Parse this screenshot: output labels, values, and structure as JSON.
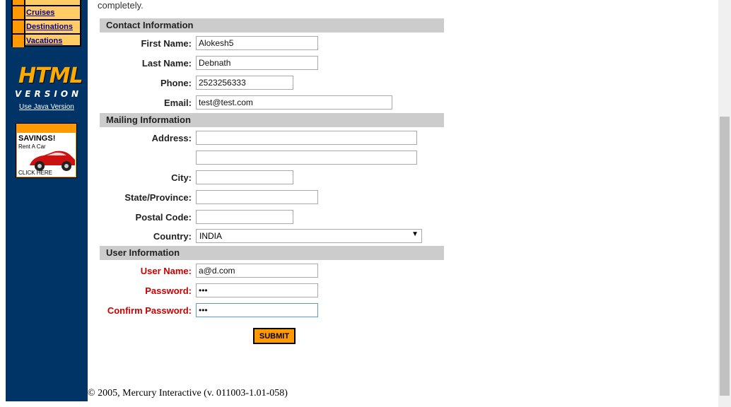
{
  "nav": {
    "items": [
      {
        "label": "Cruises"
      },
      {
        "label": "Destinations"
      },
      {
        "label": "Vacations"
      }
    ]
  },
  "logo": {
    "top": "HTML",
    "bottom": "VERSION"
  },
  "java_link": "Use Java Version",
  "ad": {
    "title": "SAVINGS!",
    "subtitle": "Rent A Car",
    "footer": "CLICK HERE"
  },
  "intro": "completely.",
  "sections": {
    "contact": "Contact Information",
    "mailing": "Mailing Information",
    "user": "User Information"
  },
  "fields": {
    "first_name": {
      "label": "First Name:",
      "value": "Alokesh5"
    },
    "last_name": {
      "label": "Last Name:",
      "value": "Debnath"
    },
    "phone": {
      "label": "Phone:",
      "value": "2523256333"
    },
    "email": {
      "label": "Email:",
      "value": "test@test.com"
    },
    "address": {
      "label": "Address:",
      "value": "",
      "value2": ""
    },
    "city": {
      "label": "City:",
      "value": ""
    },
    "state": {
      "label": "State/Province:",
      "value": ""
    },
    "postal": {
      "label": "Postal Code:",
      "value": ""
    },
    "country": {
      "label": "Country:",
      "value": "INDIA"
    },
    "user_name": {
      "label": "User Name:",
      "value": "a@d.com"
    },
    "password": {
      "label": "Password:",
      "value": "•••"
    },
    "confirm_password": {
      "label": "Confirm Password:",
      "value": "•••"
    }
  },
  "submit_label": "SUBMIT",
  "footer": "© 2005, Mercury Interactive (v. 011003-1.01-058)",
  "colors": {
    "sidebar": "#003366",
    "nav_bg": "#ffcc66",
    "accent": "#ff9900",
    "section_bar": "#cccccc",
    "required": "#cc0000"
  }
}
